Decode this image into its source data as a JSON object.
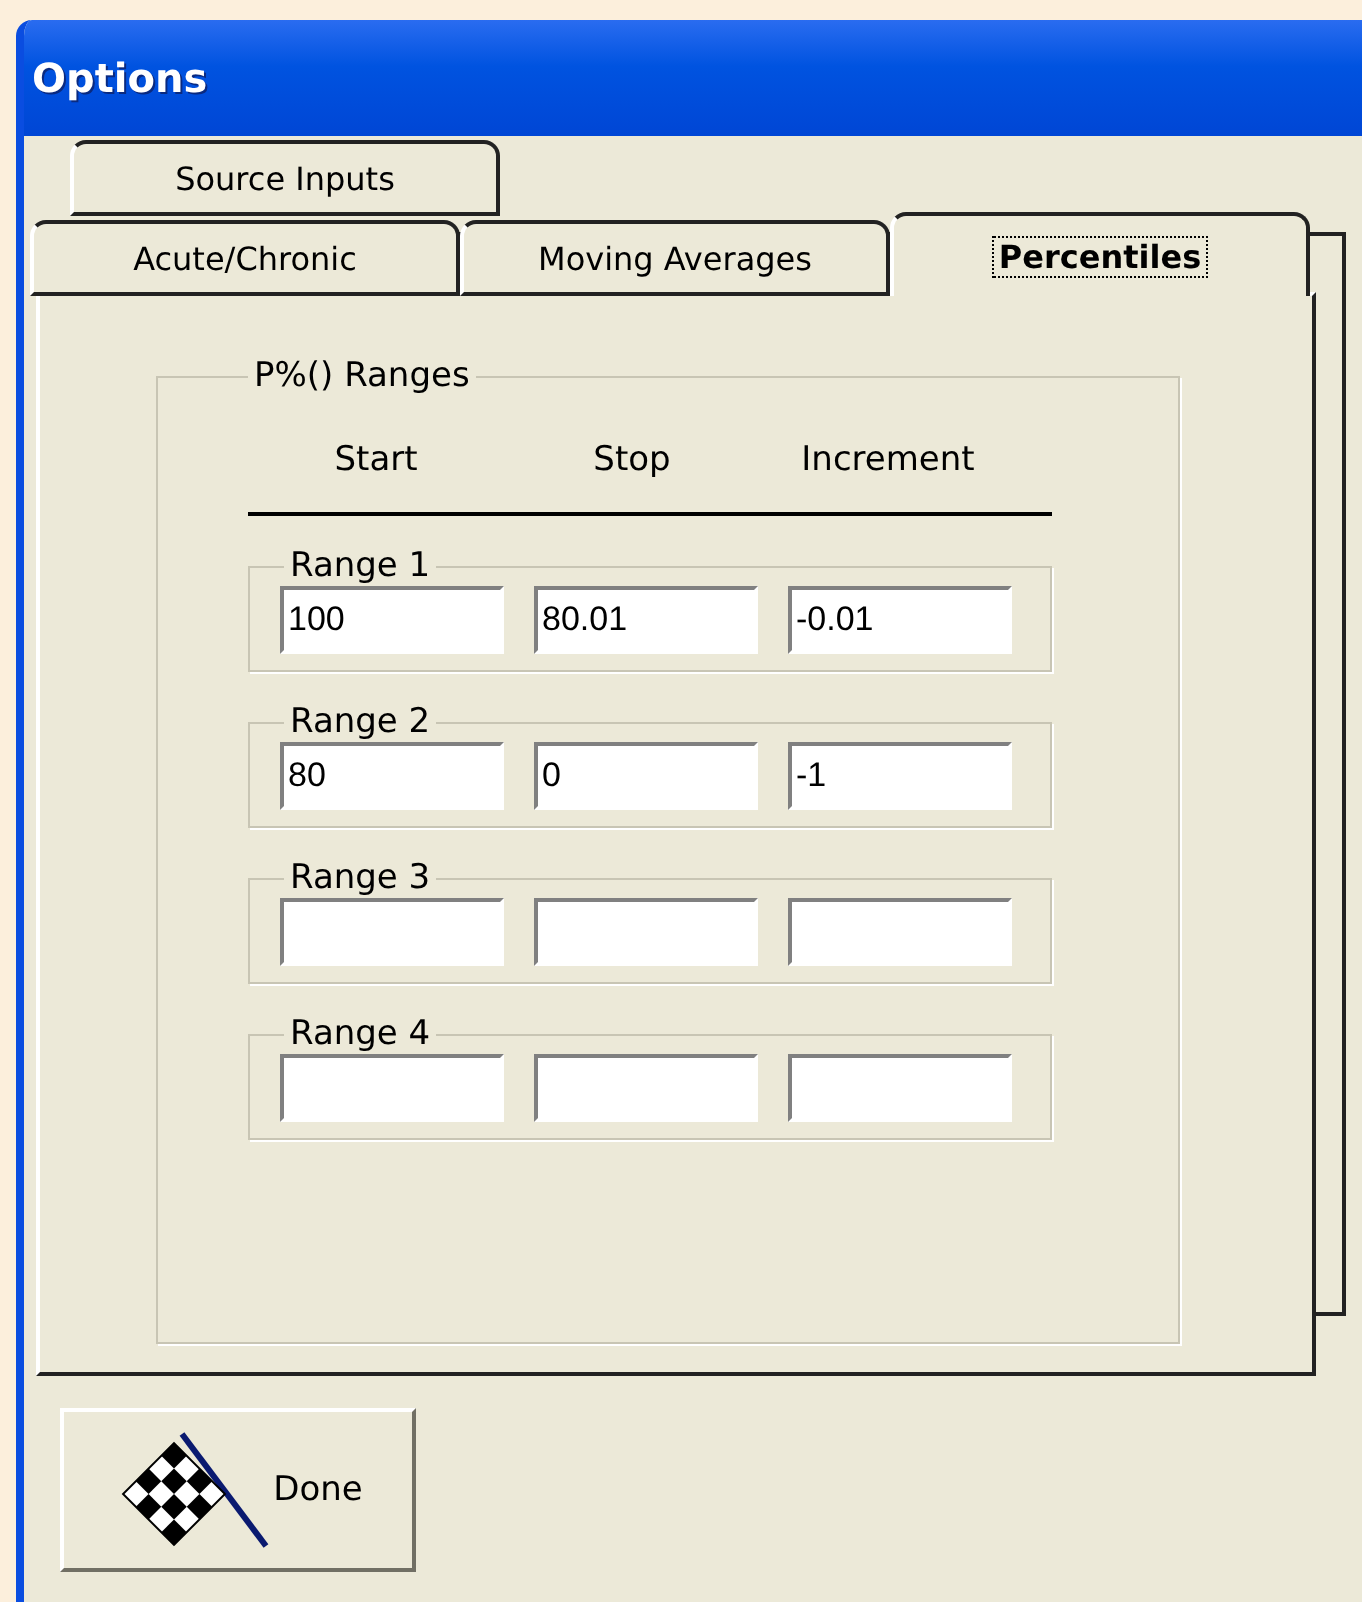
{
  "window": {
    "title": "Options"
  },
  "tab_rows": [
    [
      {
        "label": "Source Inputs",
        "selected": false
      }
    ],
    [
      {
        "label": "Acute/Chronic",
        "selected": false
      },
      {
        "label": "Moving Averages",
        "selected": false
      },
      {
        "label": "Percentiles",
        "selected": true
      }
    ]
  ],
  "group": {
    "title": "P%() Ranges",
    "columns": [
      "Start",
      "Stop",
      "Increment"
    ],
    "ranges": [
      {
        "title": "Range 1",
        "values": [
          "100",
          "80.01",
          "-0.01"
        ]
      },
      {
        "title": "Range 2",
        "values": [
          "80",
          "0",
          "-1"
        ]
      },
      {
        "title": "Range 3"
      },
      {
        "title": "Range 4"
      }
    ]
  },
  "done_button": {
    "label": "Done"
  }
}
